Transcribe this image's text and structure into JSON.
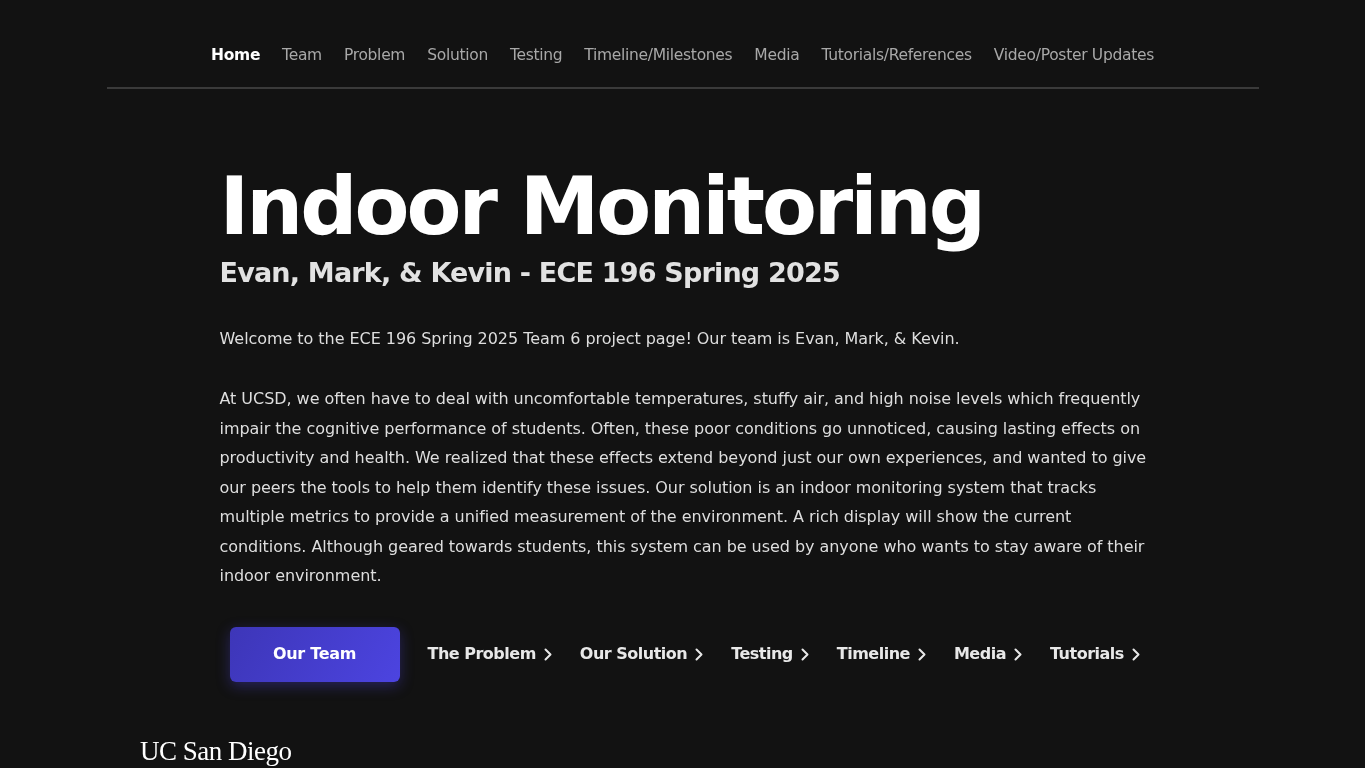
{
  "nav": {
    "items": [
      {
        "label": "Home",
        "selected": true
      },
      {
        "label": "Team",
        "selected": false
      },
      {
        "label": "Problem",
        "selected": false
      },
      {
        "label": "Solution",
        "selected": false
      },
      {
        "label": "Testing",
        "selected": false
      },
      {
        "label": "Timeline/Milestones",
        "selected": false
      },
      {
        "label": "Media",
        "selected": false
      },
      {
        "label": "Tutorials/References",
        "selected": false
      },
      {
        "label": "Video/Poster Updates",
        "selected": false
      }
    ]
  },
  "hero": {
    "title": "Indoor Monitoring",
    "subtitle": "Evan, Mark, & Kevin - ECE 196 Spring 2025",
    "paragraphs": [
      "Welcome to the ECE 196 Spring 2025 Team 6 project page! Our team is Evan, Mark, & Kevin.",
      "At UCSD, we often have to deal with uncomfortable temperatures, stuffy air, and high noise levels which frequently impair the cognitive performance of students. Often, these poor conditions go unnoticed, causing lasting effects on productivity and health. We realized that these effects extend beyond just our own experiences, and wanted to give our peers the tools to help them identify these issues. Our solution is an indoor monitoring system that tracks multiple metrics to provide a unified measurement of the environment. A rich display will show the current conditions. Although geared towards students, this system can be used by anyone who wants to stay aware of their indoor environment."
    ]
  },
  "actions": [
    {
      "label": "Our Team",
      "kind": "primary"
    },
    {
      "label": "The Problem",
      "kind": "link"
    },
    {
      "label": "Our Solution",
      "kind": "link"
    },
    {
      "label": "Testing",
      "kind": "link"
    },
    {
      "label": "Timeline",
      "kind": "link"
    },
    {
      "label": "Media",
      "kind": "link"
    },
    {
      "label": "Tutorials",
      "kind": "link"
    }
  ],
  "footer": {
    "logo": "UC San Diego"
  }
}
